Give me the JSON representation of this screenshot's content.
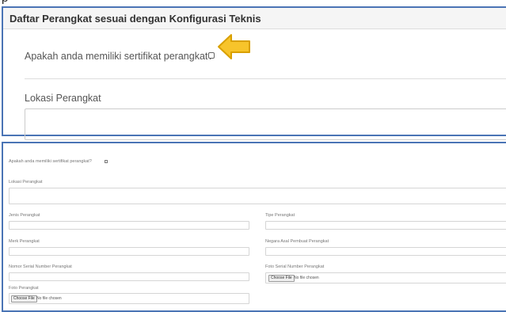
{
  "top_panel": {
    "header": "Daftar Perangkat sesuai dengan Konfigurasi Teknis",
    "cert_label": "Apakah anda memiliki sertifikat perangkat?",
    "lokasi_label": "Lokasi Perangkat"
  },
  "highlight_arrow": {
    "color": "#f7c42b",
    "outline": "#d9a000"
  },
  "form": {
    "cert_label": "Apakah anda memiliki sertifikat perangkat?",
    "lokasi_label": "Lokasi Perangkat",
    "jenis_label": "Jenis Perangkat",
    "tipe_label": "Tipe Perangkat",
    "merk_label": "Merk Perangkat",
    "negara_label": "Negara Asal Pembuat Perangkat",
    "serial_label": "Nomor Serial Number Perangkat",
    "foto_serial_label": "Foto Serial Number Perangkat",
    "foto_label": "Foto Perangkat",
    "choose_file": "Choose File",
    "no_file": "No file chosen"
  },
  "accent": "#4a74b5"
}
